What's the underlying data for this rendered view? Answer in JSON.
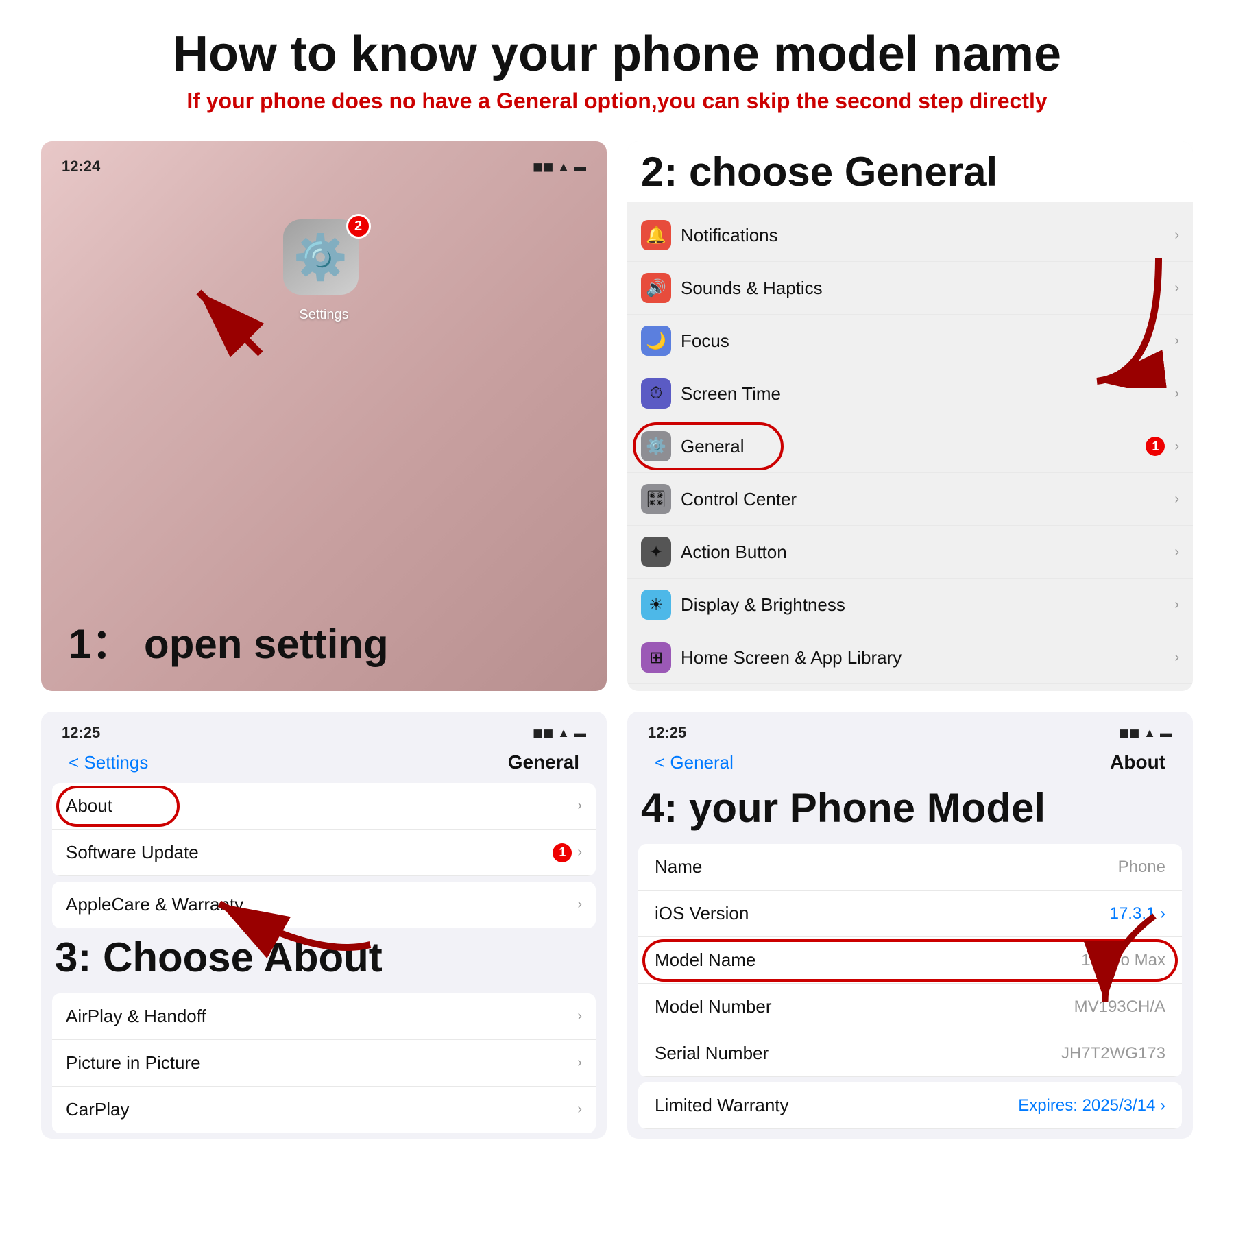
{
  "title": "How to know your phone model name",
  "subtitle": "If your phone does no have a General option,you can skip the second step directly",
  "panel1": {
    "statusbar": {
      "time": "12:24",
      "signal": "◼◼",
      "wifi": "▲",
      "battery": "▬"
    },
    "app_label": "Settings",
    "badge": "2",
    "step_label": "1：  open setting"
  },
  "panel2": {
    "step_label": "2: choose General",
    "rows": [
      {
        "icon": "🔔",
        "icon_bg": "#e74c3c",
        "label": "Notifications",
        "has_chevron": true
      },
      {
        "icon": "🔊",
        "icon_bg": "#e74c3c",
        "label": "Sounds & Haptics",
        "has_chevron": true
      },
      {
        "icon": "🌙",
        "icon_bg": "#5b7fde",
        "label": "Focus",
        "has_chevron": true
      },
      {
        "icon": "⏱",
        "icon_bg": "#5b5bc4",
        "label": "Screen Time",
        "has_chevron": true
      },
      {
        "icon": "⚙️",
        "icon_bg": "#8e8e93",
        "label": "General",
        "badge": "1",
        "has_chevron": true
      },
      {
        "icon": "🎛",
        "icon_bg": "#8e8e93",
        "label": "Control Center",
        "has_chevron": true
      },
      {
        "icon": "✦",
        "icon_bg": "#5b7fde",
        "label": "Action Button",
        "has_chevron": true
      },
      {
        "icon": "☀",
        "icon_bg": "#4db8e8",
        "label": "Display & Brightness",
        "has_chevron": true
      },
      {
        "icon": "⊞",
        "icon_bg": "#9b59b6",
        "label": "Home Screen & App Library",
        "has_chevron": true
      }
    ]
  },
  "panel3": {
    "statusbar_time": "12:25",
    "nav_back": "< Settings",
    "nav_title": "General",
    "step_label": "3: Choose About",
    "rows": [
      {
        "label": "About",
        "has_chevron": true
      },
      {
        "label": "Software Update",
        "badge": "1",
        "has_chevron": true
      }
    ],
    "rows2": [
      {
        "label": "AppleCare & Warranty",
        "has_chevron": true
      }
    ],
    "rows3": [
      {
        "label": "AirPlay & Handoff",
        "has_chevron": true
      },
      {
        "label": "Picture in Picture",
        "has_chevron": true
      },
      {
        "label": "CarPlay",
        "has_chevron": true
      }
    ]
  },
  "panel4": {
    "statusbar_time": "12:25",
    "nav_back": "< General",
    "nav_title": "About",
    "step_label": "4:  your Phone Model",
    "rows": [
      {
        "label": "Name",
        "value": "Phone",
        "value_style": "gray"
      },
      {
        "label": "iOS Version",
        "value": "17.3.1",
        "value_style": "blue",
        "has_chevron": true
      },
      {
        "label": "Model Name",
        "value": "15 Pro Max",
        "value_style": "gray",
        "circled": true
      },
      {
        "label": "Model Number",
        "value": "MV193CH/A",
        "value_style": "gray"
      },
      {
        "label": "Serial Number",
        "value": "JH7T2WG173",
        "value_style": "gray"
      }
    ],
    "rows2": [
      {
        "label": "Limited Warranty",
        "value": "Expires: 2025/3/14",
        "has_chevron": true
      }
    ]
  }
}
